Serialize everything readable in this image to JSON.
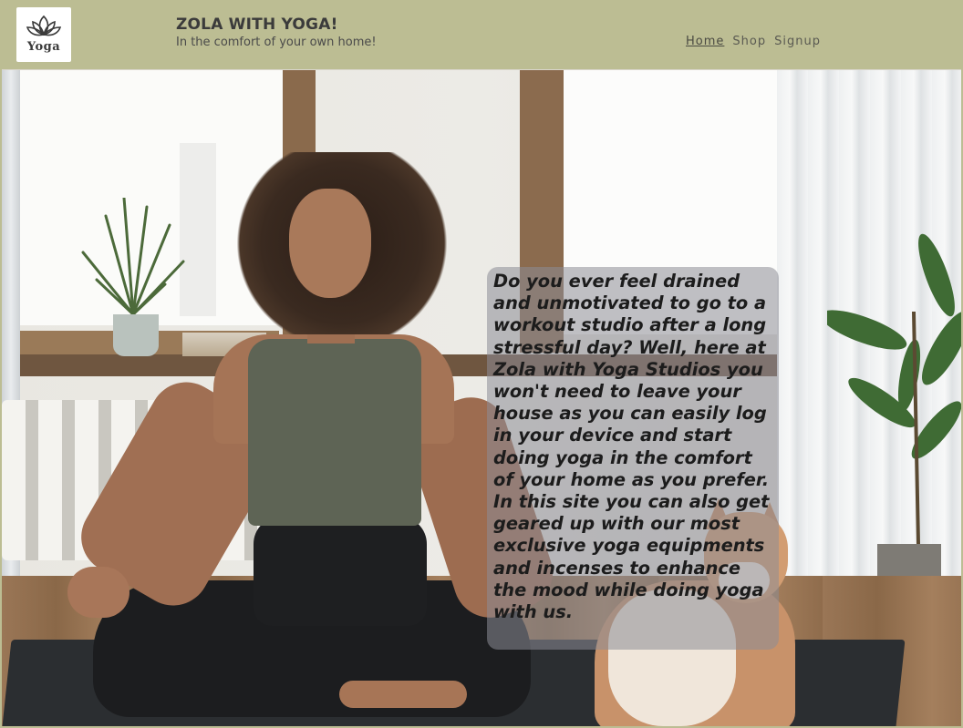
{
  "header": {
    "logo_text": "Yoga",
    "title": "ZOLA WITH YOGA!",
    "tagline": "In the comfort of your own home!"
  },
  "nav": {
    "items": [
      {
        "label": "Home",
        "active": true
      },
      {
        "label": "Shop",
        "active": false
      },
      {
        "label": "Signup",
        "active": false
      }
    ]
  },
  "hero": {
    "intro": "Do you ever feel drained and unmotivated to go to a workout studio after a long stressful day? Well, here at Zola with Yoga Studios you won't need to leave your house as you can easily log in your device and start doing yoga in the comfort of your home as you prefer. In this site you can also get geared up with our most exclusive yoga equipments and incenses to enhance the mood while doing yoga with us."
  },
  "colors": {
    "header_bg": "#bcbd93",
    "text_dark": "#3b3b3b",
    "card_overlay": "rgba(140,140,150,0.55)"
  }
}
